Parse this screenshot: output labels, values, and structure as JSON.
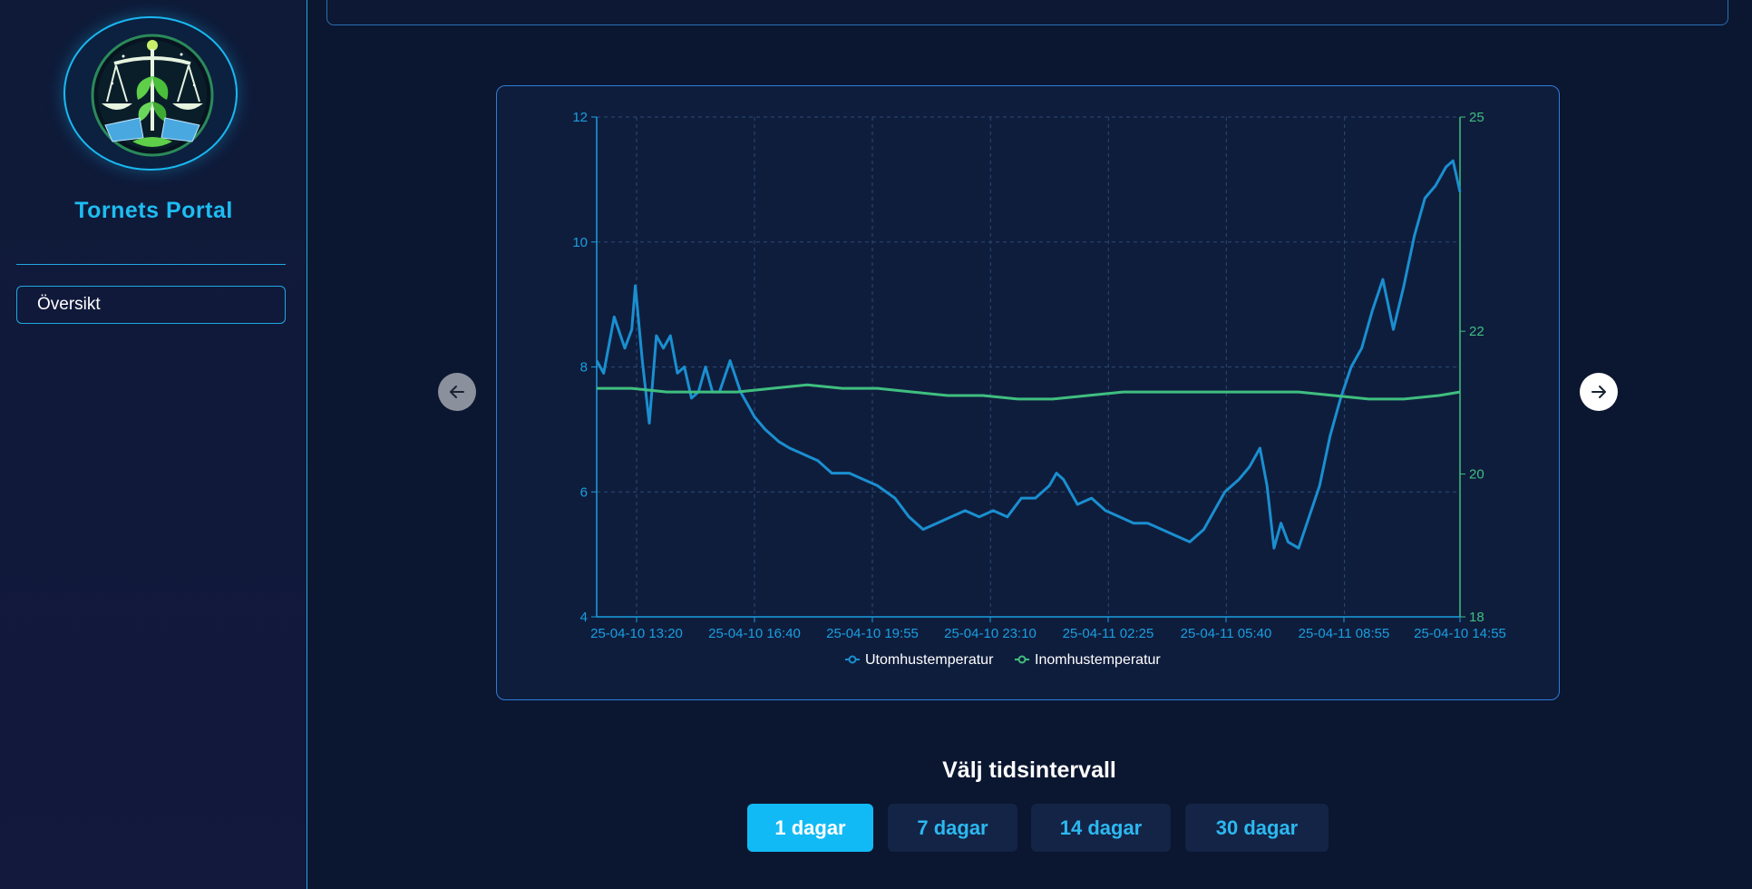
{
  "sidebar": {
    "brand": "Tornets Portal",
    "nav": [
      {
        "label": "Översikt"
      }
    ]
  },
  "chart": {
    "nav_prev_icon": "arrow-left-icon",
    "nav_next_icon": "arrow-right-icon"
  },
  "time_range": {
    "title": "Välj tidsintervall",
    "options": [
      {
        "label": "1 dagar",
        "active": true
      },
      {
        "label": "7 dagar",
        "active": false
      },
      {
        "label": "14 dagar",
        "active": false
      },
      {
        "label": "30 dagar",
        "active": false
      }
    ]
  },
  "colors": {
    "accent": "#12baf5",
    "outdoor_series": "#1a8fd0",
    "indoor_series": "#3fbf7f",
    "background": "#0b1630"
  },
  "chart_data": {
    "type": "line",
    "x_ticks": [
      "25-04-10 13:20",
      "25-04-10 16:40",
      "25-04-10 19:55",
      "25-04-10 23:10",
      "25-04-11 02:25",
      "25-04-11 05:40",
      "25-04-11 08:55",
      "25-04-10 14:55"
    ],
    "y_left": {
      "ticks": [
        4,
        6,
        8,
        10,
        12
      ],
      "range": [
        4,
        12
      ]
    },
    "y_right": {
      "ticks": [
        18,
        20,
        22,
        25
      ],
      "range": [
        18,
        25
      ]
    },
    "x_range_hours": [
      0,
      24.6
    ],
    "grid": true,
    "legend_position": "bottom",
    "series": [
      {
        "name": "Utomhustemperatur",
        "axis": "left",
        "points": [
          [
            0,
            8.1
          ],
          [
            0.2,
            7.9
          ],
          [
            0.5,
            8.8
          ],
          [
            0.8,
            8.3
          ],
          [
            1.0,
            8.6
          ],
          [
            1.1,
            9.3
          ],
          [
            1.3,
            8.1
          ],
          [
            1.5,
            7.1
          ],
          [
            1.7,
            8.5
          ],
          [
            1.9,
            8.3
          ],
          [
            2.1,
            8.5
          ],
          [
            2.3,
            7.9
          ],
          [
            2.5,
            8.0
          ],
          [
            2.7,
            7.5
          ],
          [
            2.9,
            7.6
          ],
          [
            3.1,
            8.0
          ],
          [
            3.3,
            7.6
          ],
          [
            3.5,
            7.6
          ],
          [
            3.8,
            8.1
          ],
          [
            4.1,
            7.6
          ],
          [
            4.3,
            7.4
          ],
          [
            4.5,
            7.2
          ],
          [
            4.8,
            7.0
          ],
          [
            5.2,
            6.8
          ],
          [
            5.5,
            6.7
          ],
          [
            5.9,
            6.6
          ],
          [
            6.3,
            6.5
          ],
          [
            6.7,
            6.3
          ],
          [
            7.2,
            6.3
          ],
          [
            7.6,
            6.2
          ],
          [
            8.0,
            6.1
          ],
          [
            8.5,
            5.9
          ],
          [
            8.9,
            5.6
          ],
          [
            9.3,
            5.4
          ],
          [
            9.7,
            5.5
          ],
          [
            10.1,
            5.6
          ],
          [
            10.5,
            5.7
          ],
          [
            10.9,
            5.6
          ],
          [
            11.3,
            5.7
          ],
          [
            11.7,
            5.6
          ],
          [
            12.1,
            5.9
          ],
          [
            12.5,
            5.9
          ],
          [
            12.9,
            6.1
          ],
          [
            13.1,
            6.3
          ],
          [
            13.3,
            6.2
          ],
          [
            13.7,
            5.8
          ],
          [
            14.1,
            5.9
          ],
          [
            14.5,
            5.7
          ],
          [
            14.9,
            5.6
          ],
          [
            15.3,
            5.5
          ],
          [
            15.7,
            5.5
          ],
          [
            16.1,
            5.4
          ],
          [
            16.5,
            5.3
          ],
          [
            16.9,
            5.2
          ],
          [
            17.3,
            5.4
          ],
          [
            17.6,
            5.7
          ],
          [
            17.9,
            6.0
          ],
          [
            18.3,
            6.2
          ],
          [
            18.6,
            6.4
          ],
          [
            18.9,
            6.7
          ],
          [
            19.1,
            6.1
          ],
          [
            19.3,
            5.1
          ],
          [
            19.5,
            5.5
          ],
          [
            19.7,
            5.2
          ],
          [
            20.0,
            5.1
          ],
          [
            20.3,
            5.6
          ],
          [
            20.6,
            6.1
          ],
          [
            20.9,
            6.9
          ],
          [
            21.2,
            7.5
          ],
          [
            21.5,
            8.0
          ],
          [
            21.8,
            8.3
          ],
          [
            22.1,
            8.9
          ],
          [
            22.4,
            9.4
          ],
          [
            22.7,
            8.6
          ],
          [
            23.0,
            9.3
          ],
          [
            23.3,
            10.1
          ],
          [
            23.6,
            10.7
          ],
          [
            23.9,
            10.9
          ],
          [
            24.2,
            11.2
          ],
          [
            24.4,
            11.3
          ],
          [
            24.6,
            10.8
          ]
        ]
      },
      {
        "name": "Inomhustemperatur",
        "axis": "right",
        "points": [
          [
            0,
            21.2
          ],
          [
            1.0,
            21.2
          ],
          [
            2.0,
            21.15
          ],
          [
            3.0,
            21.15
          ],
          [
            4.0,
            21.15
          ],
          [
            5.0,
            21.2
          ],
          [
            6.0,
            21.25
          ],
          [
            7.0,
            21.2
          ],
          [
            8.0,
            21.2
          ],
          [
            9.0,
            21.15
          ],
          [
            10.0,
            21.1
          ],
          [
            11.0,
            21.1
          ],
          [
            12.0,
            21.05
          ],
          [
            13.0,
            21.05
          ],
          [
            14.0,
            21.1
          ],
          [
            15.0,
            21.15
          ],
          [
            16.0,
            21.15
          ],
          [
            17.0,
            21.15
          ],
          [
            18.0,
            21.15
          ],
          [
            19.0,
            21.15
          ],
          [
            20.0,
            21.15
          ],
          [
            21.0,
            21.1
          ],
          [
            22.0,
            21.05
          ],
          [
            23.0,
            21.05
          ],
          [
            24.0,
            21.1
          ],
          [
            24.6,
            21.15
          ]
        ]
      }
    ]
  }
}
